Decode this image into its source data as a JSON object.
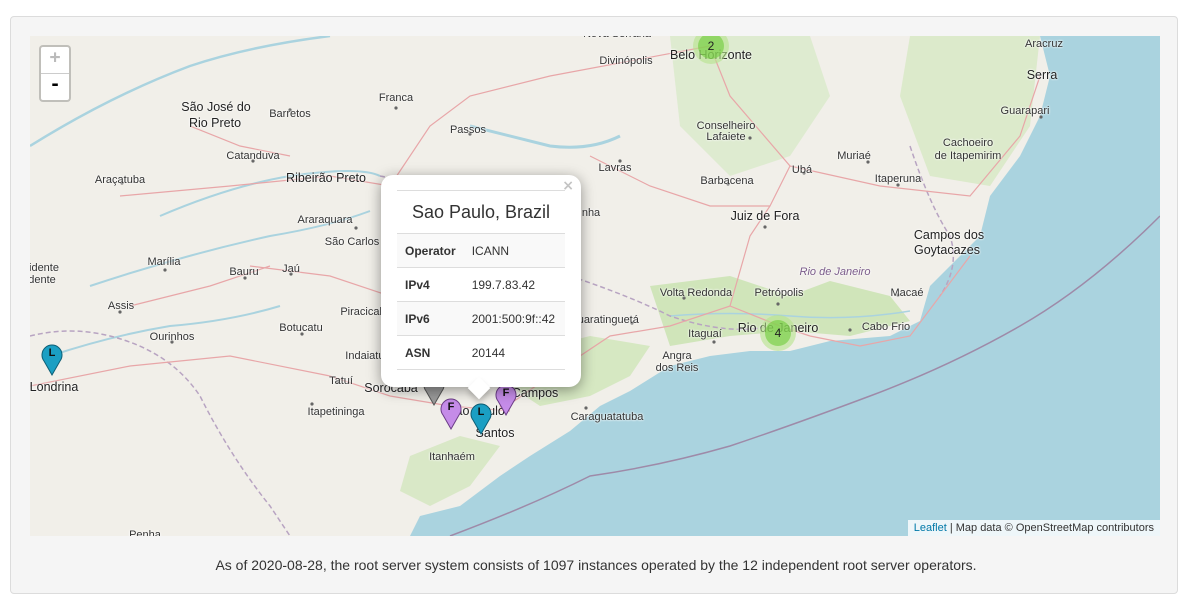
{
  "map": {
    "zoom_in_label": "+",
    "zoom_out_label": "-",
    "attribution_link": "Leaflet",
    "attribution_text": " | Map data © OpenStreetMap contributors",
    "colors": {
      "land": "#f1efe9",
      "water": "#aad3df",
      "greenery": "#cfe6b8",
      "roads": "#e8a6a8",
      "borders": "#9e8aa8",
      "cluster_outer": "#b5e28c",
      "cluster_inner": "#6ecc39",
      "pin_l": "#1b9fc3",
      "pin_f": "#c58ce8"
    },
    "places": [
      {
        "name": "Nova Serrana",
        "kind": "city"
      },
      {
        "name": "Belo Horizonte",
        "kind": "big"
      },
      {
        "name": "Divinópolis",
        "kind": "city"
      },
      {
        "name": "Aracruz",
        "kind": "city"
      },
      {
        "name": "Serra",
        "kind": "big"
      },
      {
        "name": "Guarapari",
        "kind": "city"
      },
      {
        "name": "São José do",
        "kind": "big"
      },
      {
        "name": "Rio Preto",
        "kind": "big"
      },
      {
        "name": "Barretos",
        "kind": "city"
      },
      {
        "name": "Franca",
        "kind": "city"
      },
      {
        "name": "Passos",
        "kind": "city"
      },
      {
        "name": "Conselheiro",
        "kind": "city"
      },
      {
        "name": "Lafaiete",
        "kind": "city"
      },
      {
        "name": "Cachoeiro",
        "kind": "city"
      },
      {
        "name": "de Itapemirim",
        "kind": "city"
      },
      {
        "name": "Catanduva",
        "kind": "city"
      },
      {
        "name": "Araçatuba",
        "kind": "city"
      },
      {
        "name": "Ribeirão Preto",
        "kind": "big"
      },
      {
        "name": "Lavras",
        "kind": "city"
      },
      {
        "name": "Barbacena",
        "kind": "city"
      },
      {
        "name": "Ubá",
        "kind": "city"
      },
      {
        "name": "Muriaé",
        "kind": "city"
      },
      {
        "name": "Itaperuna",
        "kind": "city"
      },
      {
        "name": "Araraquara",
        "kind": "city"
      },
      {
        "name": "São Carlos",
        "kind": "city"
      },
      {
        "name": "Juiz de Fora",
        "kind": "big"
      },
      {
        "name": "Campos dos",
        "kind": "big"
      },
      {
        "name": "Goytacazes",
        "kind": "big"
      },
      {
        "name": "idente",
        "kind": "city"
      },
      {
        "name": "dente",
        "kind": "city"
      },
      {
        "name": "Marília",
        "kind": "city"
      },
      {
        "name": "Bauru",
        "kind": "city"
      },
      {
        "name": "Jaú",
        "kind": "city"
      },
      {
        "name": "Rio de Janeiro",
        "kind": "region"
      },
      {
        "name": "Volta Redonda",
        "kind": "city"
      },
      {
        "name": "Petrópolis",
        "kind": "city"
      },
      {
        "name": "Macaé",
        "kind": "city"
      },
      {
        "name": "Assis",
        "kind": "city"
      },
      {
        "name": "Botucatu",
        "kind": "city"
      },
      {
        "name": "Piracicaba",
        "kind": "city"
      },
      {
        "name": "Guaratinguetá",
        "kind": "city"
      },
      {
        "name": "Itaguaí",
        "kind": "city"
      },
      {
        "name": "Rio de Janeiro",
        "kind": "big"
      },
      {
        "name": "Cabo Frio",
        "kind": "city"
      },
      {
        "name": "Ourinhos",
        "kind": "city"
      },
      {
        "name": "Indaiatuba",
        "kind": "city"
      },
      {
        "name": "Angra",
        "kind": "city"
      },
      {
        "name": "dos Reis",
        "kind": "city"
      },
      {
        "name": "Londrina",
        "kind": "big"
      },
      {
        "name": "Tatuí",
        "kind": "city"
      },
      {
        "name": "Sorocaba",
        "kind": "big"
      },
      {
        "name": "Campos",
        "kind": "big"
      },
      {
        "name": "Itapetininga",
        "kind": "city"
      },
      {
        "name": "São Paulo",
        "kind": "big"
      },
      {
        "name": "Caraguatatuba",
        "kind": "city"
      },
      {
        "name": "Santos",
        "kind": "big"
      },
      {
        "name": "Itanhaém",
        "kind": "city"
      },
      {
        "name": "Penha",
        "kind": "city"
      },
      {
        "name": "nha",
        "kind": "city"
      }
    ],
    "clusters": [
      {
        "count": "2",
        "name": "belo-horizonte-cluster"
      },
      {
        "count": "4",
        "name": "rio-de-janeiro-cluster"
      }
    ],
    "markers": [
      {
        "letter": "L",
        "name": "londrina-l-root-marker"
      },
      {
        "letter": "F",
        "name": "sao-paulo-f-root-marker"
      },
      {
        "letter": "L",
        "name": "sao-paulo-l-root-marker"
      },
      {
        "letter": "F",
        "name": "campos-f-root-marker"
      }
    ]
  },
  "popup": {
    "close_label": "×",
    "title": "Sao Paulo, Brazil",
    "rows": [
      {
        "key": "Operator",
        "value": "ICANN"
      },
      {
        "key": "IPv4",
        "value": "199.7.83.42"
      },
      {
        "key": "IPv6",
        "value": "2001:500:9f::42"
      },
      {
        "key": "ASN",
        "value": "20144"
      }
    ]
  },
  "caption": "As of 2020-08-28, the root server system consists of 1097 instances operated by the 12 independent root server operators."
}
